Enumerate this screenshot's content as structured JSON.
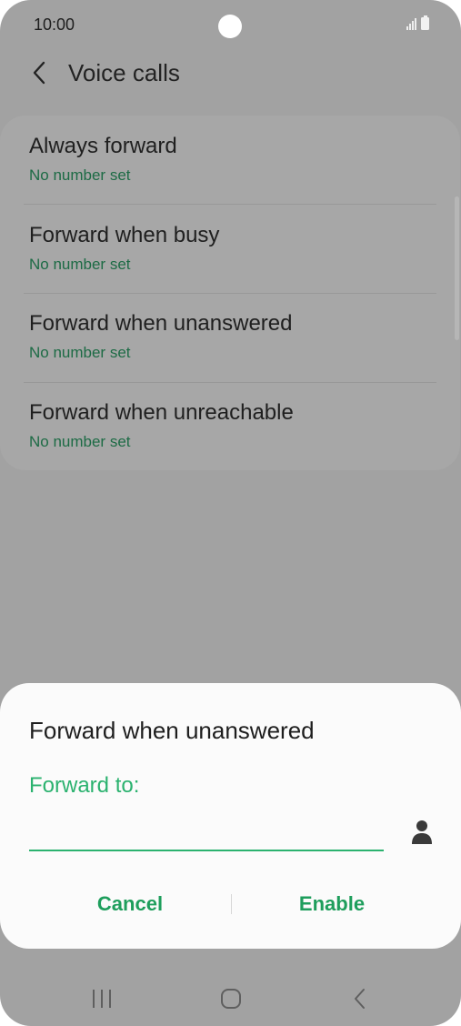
{
  "status_bar": {
    "time": "10:00",
    "signal_icon": "signal-icon",
    "battery_icon": "battery-icon"
  },
  "app_bar": {
    "title": "Voice calls",
    "back_icon": "back-arrow-icon"
  },
  "list": {
    "items": [
      {
        "title": "Always forward",
        "subtitle": "No number set"
      },
      {
        "title": "Forward when busy",
        "subtitle": "No number set"
      },
      {
        "title": "Forward when unanswered",
        "subtitle": "No number set"
      },
      {
        "title": "Forward when unreachable",
        "subtitle": "No number set"
      }
    ]
  },
  "dialog": {
    "title": "Forward when unanswered",
    "field_label": "Forward to:",
    "field_value": "",
    "contact_icon": "contact-person-icon",
    "cancel_label": "Cancel",
    "enable_label": "Enable"
  },
  "nav_bar": {
    "recents_icon": "recents-icon",
    "home_icon": "home-icon",
    "back_icon": "nav-back-icon"
  },
  "colors": {
    "accent": "#2bb26f",
    "accent_button": "#1e9e5c",
    "subtitle_dimmed": "#1d6b45",
    "scrim": "#a2a2a2",
    "dialog_bg": "#fbfbfb"
  }
}
